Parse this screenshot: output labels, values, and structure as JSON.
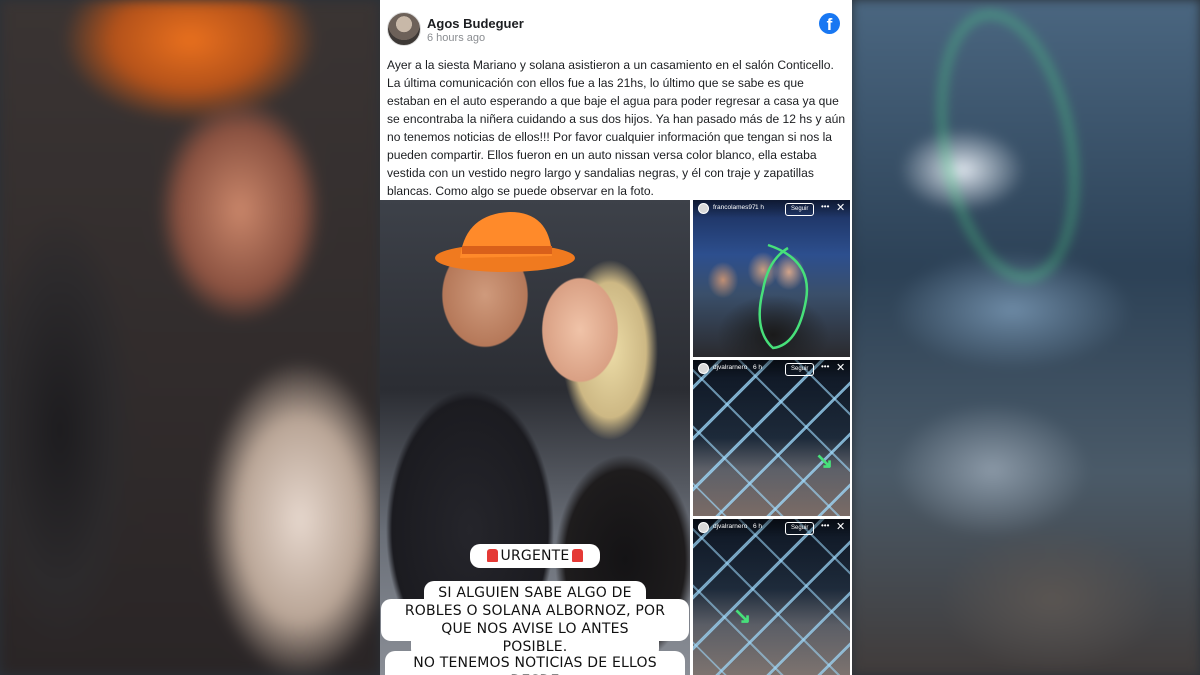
{
  "post": {
    "author": "Agos Budeguer",
    "time": "6 hours ago",
    "platform_icon": "facebook-icon",
    "text": "Ayer a la siesta Mariano y solana asistieron a un casamiento en el salón Conticello. La última comunicación con ellos fue a las 21hs, lo último que se sabe es que estaban en el auto esperando a que baje el agua para poder regresar a casa ya que se encontraba la niñera cuidando a sus dos hijos. Ya han pasado más de 12 hs y aún no tenemos noticias de ellos!!! Por favor cualquier información que tengan si nos la pueden compartir. Ellos fueron en un auto nissan versa color blanco, ella estaba vestida con un vestido negro largo y sandalias negras, y él con traje y zapatillas blancas. Como algo se puede observar en la foto."
  },
  "main_photo": {
    "stickers": {
      "urgent": "URGENTE",
      "line1": "SI ALGUIEN SABE ALGO DE MARIANO",
      "line2": "ROBLES O SOLANA ALBORNOZ, POR FAVOR",
      "line3": "QUE NOS AVISE LO ANTES POSIBLE.",
      "line4": "NO TENEMOS NOTICIAS DE ELLOS DESDE"
    }
  },
  "stories": [
    {
      "user": "francolames97",
      "age": "1 h",
      "follow": "Seguir"
    },
    {
      "user": "djvalrarnero",
      "age": "6 h",
      "follow": "Seguir"
    },
    {
      "user": "djvalrarnero",
      "age": "6 h",
      "follow": "Seguir"
    }
  ],
  "colors": {
    "facebook_blue": "#1877f2",
    "accent_green": "#47e07a"
  }
}
